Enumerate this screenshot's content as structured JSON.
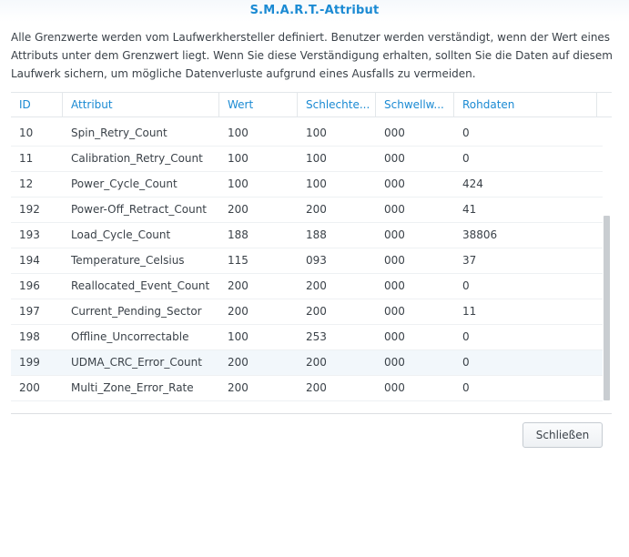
{
  "window": {
    "title": "S.M.A.R.T.-Attribut"
  },
  "description": "Alle Grenzwerte werden vom Laufwerkhersteller definiert. Benutzer werden verständigt, wenn der Wert eines Attributs unter dem Grenzwert liegt. Wenn Sie diese Verständigung erhalten, sollten Sie die Daten auf diesem Laufwerk sichern, um mögliche Datenverluste aufgrund eines Ausfalls zu vermeiden.",
  "table": {
    "columns": {
      "id": "ID",
      "attribute": "Attribut",
      "value": "Wert",
      "worst": "Schlechte...",
      "threshold": "Schwellw...",
      "raw": "Rohdaten"
    },
    "rows": [
      {
        "id": "10",
        "attribute": "Spin_Retry_Count",
        "value": "100",
        "worst": "100",
        "threshold": "000",
        "raw": "0"
      },
      {
        "id": "11",
        "attribute": "Calibration_Retry_Count",
        "value": "100",
        "worst": "100",
        "threshold": "000",
        "raw": "0"
      },
      {
        "id": "12",
        "attribute": "Power_Cycle_Count",
        "value": "100",
        "worst": "100",
        "threshold": "000",
        "raw": "424"
      },
      {
        "id": "192",
        "attribute": "Power-Off_Retract_Count",
        "value": "200",
        "worst": "200",
        "threshold": "000",
        "raw": "41"
      },
      {
        "id": "193",
        "attribute": "Load_Cycle_Count",
        "value": "188",
        "worst": "188",
        "threshold": "000",
        "raw": "38806"
      },
      {
        "id": "194",
        "attribute": "Temperature_Celsius",
        "value": "115",
        "worst": "093",
        "threshold": "000",
        "raw": "37"
      },
      {
        "id": "196",
        "attribute": "Reallocated_Event_Count",
        "value": "200",
        "worst": "200",
        "threshold": "000",
        "raw": "0"
      },
      {
        "id": "197",
        "attribute": "Current_Pending_Sector",
        "value": "200",
        "worst": "200",
        "threshold": "000",
        "raw": "11"
      },
      {
        "id": "198",
        "attribute": "Offline_Uncorrectable",
        "value": "100",
        "worst": "253",
        "threshold": "000",
        "raw": "0"
      },
      {
        "id": "199",
        "attribute": "UDMA_CRC_Error_Count",
        "value": "200",
        "worst": "200",
        "threshold": "000",
        "raw": "0"
      },
      {
        "id": "200",
        "attribute": "Multi_Zone_Error_Rate",
        "value": "200",
        "worst": "200",
        "threshold": "000",
        "raw": "0"
      }
    ],
    "selected_row_id": "199"
  },
  "buttons": {
    "close_label": "Schließen"
  },
  "colors": {
    "accent": "#1a8ad3",
    "selected_row": "#f2f7fb"
  }
}
